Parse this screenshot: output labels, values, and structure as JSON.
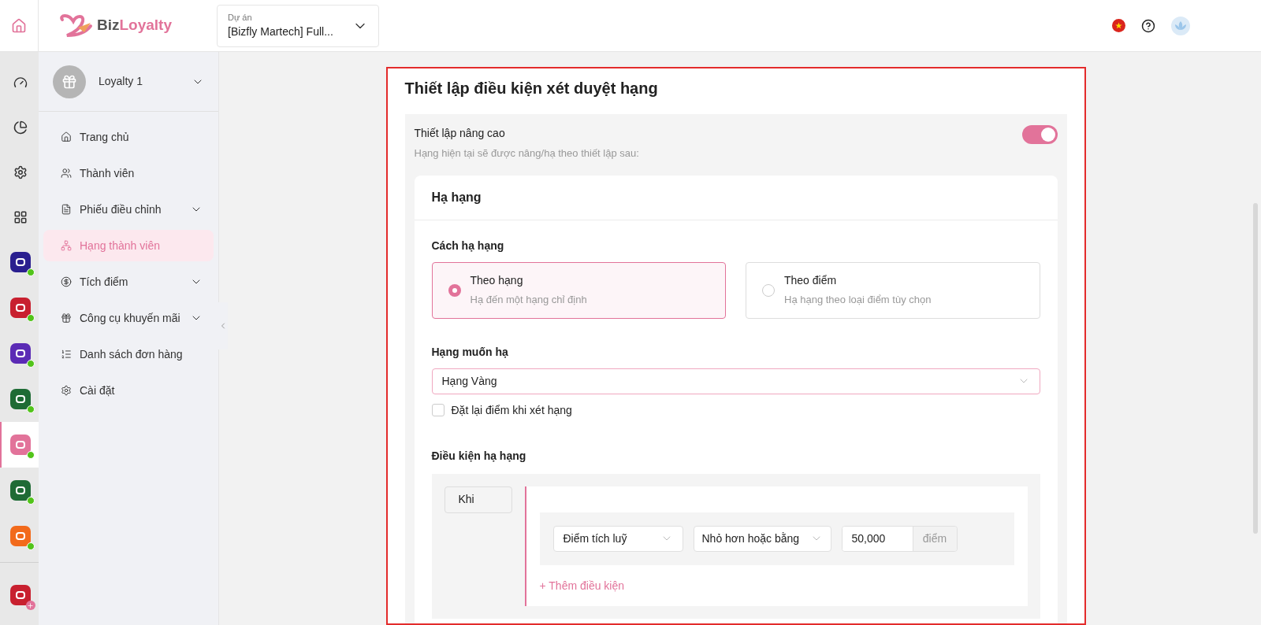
{
  "header": {
    "brand_first": "Biz",
    "brand_second": "Loyalty",
    "project_label": "Dự án",
    "project_value": "[Bizfly Martech] Full..."
  },
  "rail": [
    {
      "kind": "nav",
      "selected": false
    },
    {
      "kind": "nav",
      "selected": false
    },
    {
      "kind": "nav",
      "selected": false
    },
    {
      "kind": "nav",
      "selected": false
    },
    {
      "kind": "app",
      "color": "#2a1f8f",
      "online": true,
      "selected": false
    },
    {
      "kind": "app",
      "color": "#c8202f",
      "online": true,
      "selected": false
    },
    {
      "kind": "app",
      "color": "#5b2bb5",
      "online": true,
      "selected": false
    },
    {
      "kind": "app",
      "color": "#1f6b35",
      "online": true,
      "selected": false
    },
    {
      "kind": "app",
      "color": "#e2739a",
      "online": true,
      "selected": true
    },
    {
      "kind": "app",
      "color": "#1f6b35",
      "online": true,
      "selected": false
    },
    {
      "kind": "app",
      "color": "#f26a1b",
      "online": true,
      "selected": false
    },
    {
      "kind": "add",
      "color": "#c8202f",
      "selected": false
    }
  ],
  "sidebar": {
    "account": "Loyalty 1",
    "items": [
      {
        "label": "Trang chủ",
        "has_children": false,
        "selected": false
      },
      {
        "label": "Thành viên",
        "has_children": false,
        "selected": false
      },
      {
        "label": "Phiếu điều chỉnh",
        "has_children": true,
        "selected": false
      },
      {
        "label": "Hạng thành viên",
        "has_children": false,
        "selected": true
      },
      {
        "label": "Tích điểm",
        "has_children": true,
        "selected": false
      },
      {
        "label": "Công cụ khuyến mãi",
        "has_children": true,
        "selected": false
      },
      {
        "label": "Danh sách đơn hàng",
        "has_children": false,
        "selected": false
      },
      {
        "label": "Cài đặt",
        "has_children": false,
        "selected": false
      }
    ]
  },
  "section": {
    "title": "Thiết lập điều kiện xét duyệt hạng",
    "advanced": {
      "label": "Thiết lập nâng cao",
      "description": "Hạng hiện tại sẽ được nâng/hạ theo thiết lập sau:",
      "on": true
    },
    "card": {
      "title": "Hạ hạng",
      "method_label": "Cách hạ hạng",
      "methods": [
        {
          "title": "Theo hạng",
          "description": "Hạ đến một hạng chỉ định",
          "selected": true
        },
        {
          "title": "Theo điểm",
          "description": "Hạ hạng theo loại điểm tùy chọn",
          "selected": false
        }
      ],
      "target_label": "Hạng muốn hạ",
      "target_value": "Hạng Vàng",
      "reset": {
        "label": "Đặt lại điểm khi xét hạng",
        "checked": false
      },
      "conditions_label": "Điều kiện hạ hạng",
      "when_label": "Khi",
      "condition": {
        "field": "Điểm tích luỹ",
        "operator": "Nhỏ hơn hoặc bằng",
        "value": "50,000",
        "unit": "điểm"
      },
      "add_condition": "+ Thêm điều kiện"
    }
  }
}
